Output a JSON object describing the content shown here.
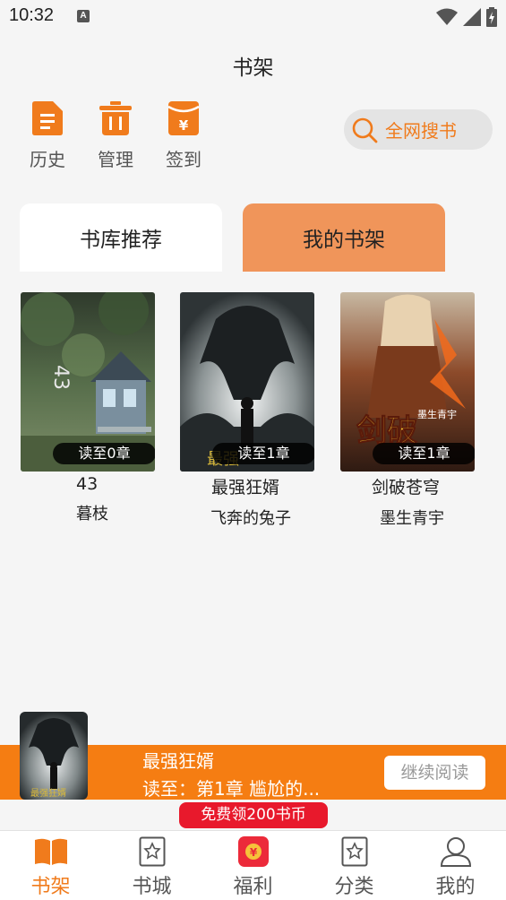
{
  "status_bar": {
    "time": "10:32",
    "indicator": "A"
  },
  "header": {
    "title": "书架"
  },
  "quick_actions": [
    {
      "label": "历史",
      "icon": "document-icon"
    },
    {
      "label": "管理",
      "icon": "trash-icon"
    },
    {
      "label": "签到",
      "icon": "yen-envelope-icon"
    }
  ],
  "search": {
    "label": "全网搜书",
    "icon": "search-icon"
  },
  "tabs": [
    {
      "label": "书库推荐",
      "active": false
    },
    {
      "label": "我的书架",
      "active": true
    }
  ],
  "books": [
    {
      "title": "43",
      "author": "暮枝",
      "progress": "读至0章",
      "cover_text": "43"
    },
    {
      "title": "最强狂婿",
      "author": "飞奔的兔子",
      "progress": "读至1章",
      "cover_text": "最强狂婿"
    },
    {
      "title": "剑破苍穹",
      "author": "墨生青宇",
      "progress": "读至1章",
      "cover_text": "剑破苍穹"
    }
  ],
  "continue_reading": {
    "title": "最强狂婿",
    "chapter": "读至：第1章 尴尬的...",
    "button": "继续阅读",
    "cover_text": "最强狂婿"
  },
  "promo": {
    "label": "免费领200书币"
  },
  "bottom_nav": [
    {
      "label": "书架",
      "icon": "open-book-icon",
      "active": true
    },
    {
      "label": "书城",
      "icon": "star-book-icon",
      "active": false
    },
    {
      "label": "福利",
      "icon": "gift-envelope-icon",
      "active": false
    },
    {
      "label": "分类",
      "icon": "category-book-icon",
      "active": false
    },
    {
      "label": "我的",
      "icon": "user-icon",
      "active": false
    }
  ],
  "colors": {
    "accent": "#f07b1c",
    "tab_active": "#f0955a",
    "continue_bar": "#f57d12",
    "promo": "#e8192c"
  }
}
